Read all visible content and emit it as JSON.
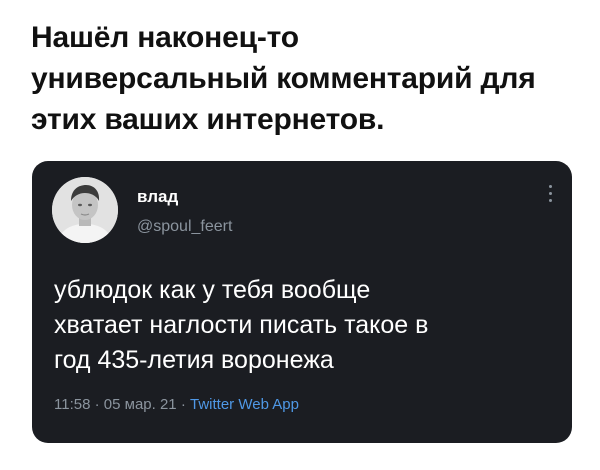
{
  "caption": {
    "line1": "Нашёл наконец-то",
    "line2": "универсальный комментарий для",
    "line3": "этих ваших интернетов."
  },
  "tweet": {
    "display_name": "влад",
    "handle": "@spoul_feert",
    "text_line1": "ублюдок как у тебя вообще",
    "text_line2": "хватает наглости писать такое в",
    "text_line3": "год 435-летия воронежа",
    "time": "11:58",
    "separator": "·",
    "date": "05 мар. 21",
    "source": "Twitter Web App"
  },
  "colors": {
    "card_bg": "#1b1d22",
    "text_primary": "#ffffff",
    "text_secondary": "#8b949e",
    "link": "#4f98e6"
  },
  "icons": {
    "avatar": "user-photo",
    "more": "more-vertical-icon"
  }
}
